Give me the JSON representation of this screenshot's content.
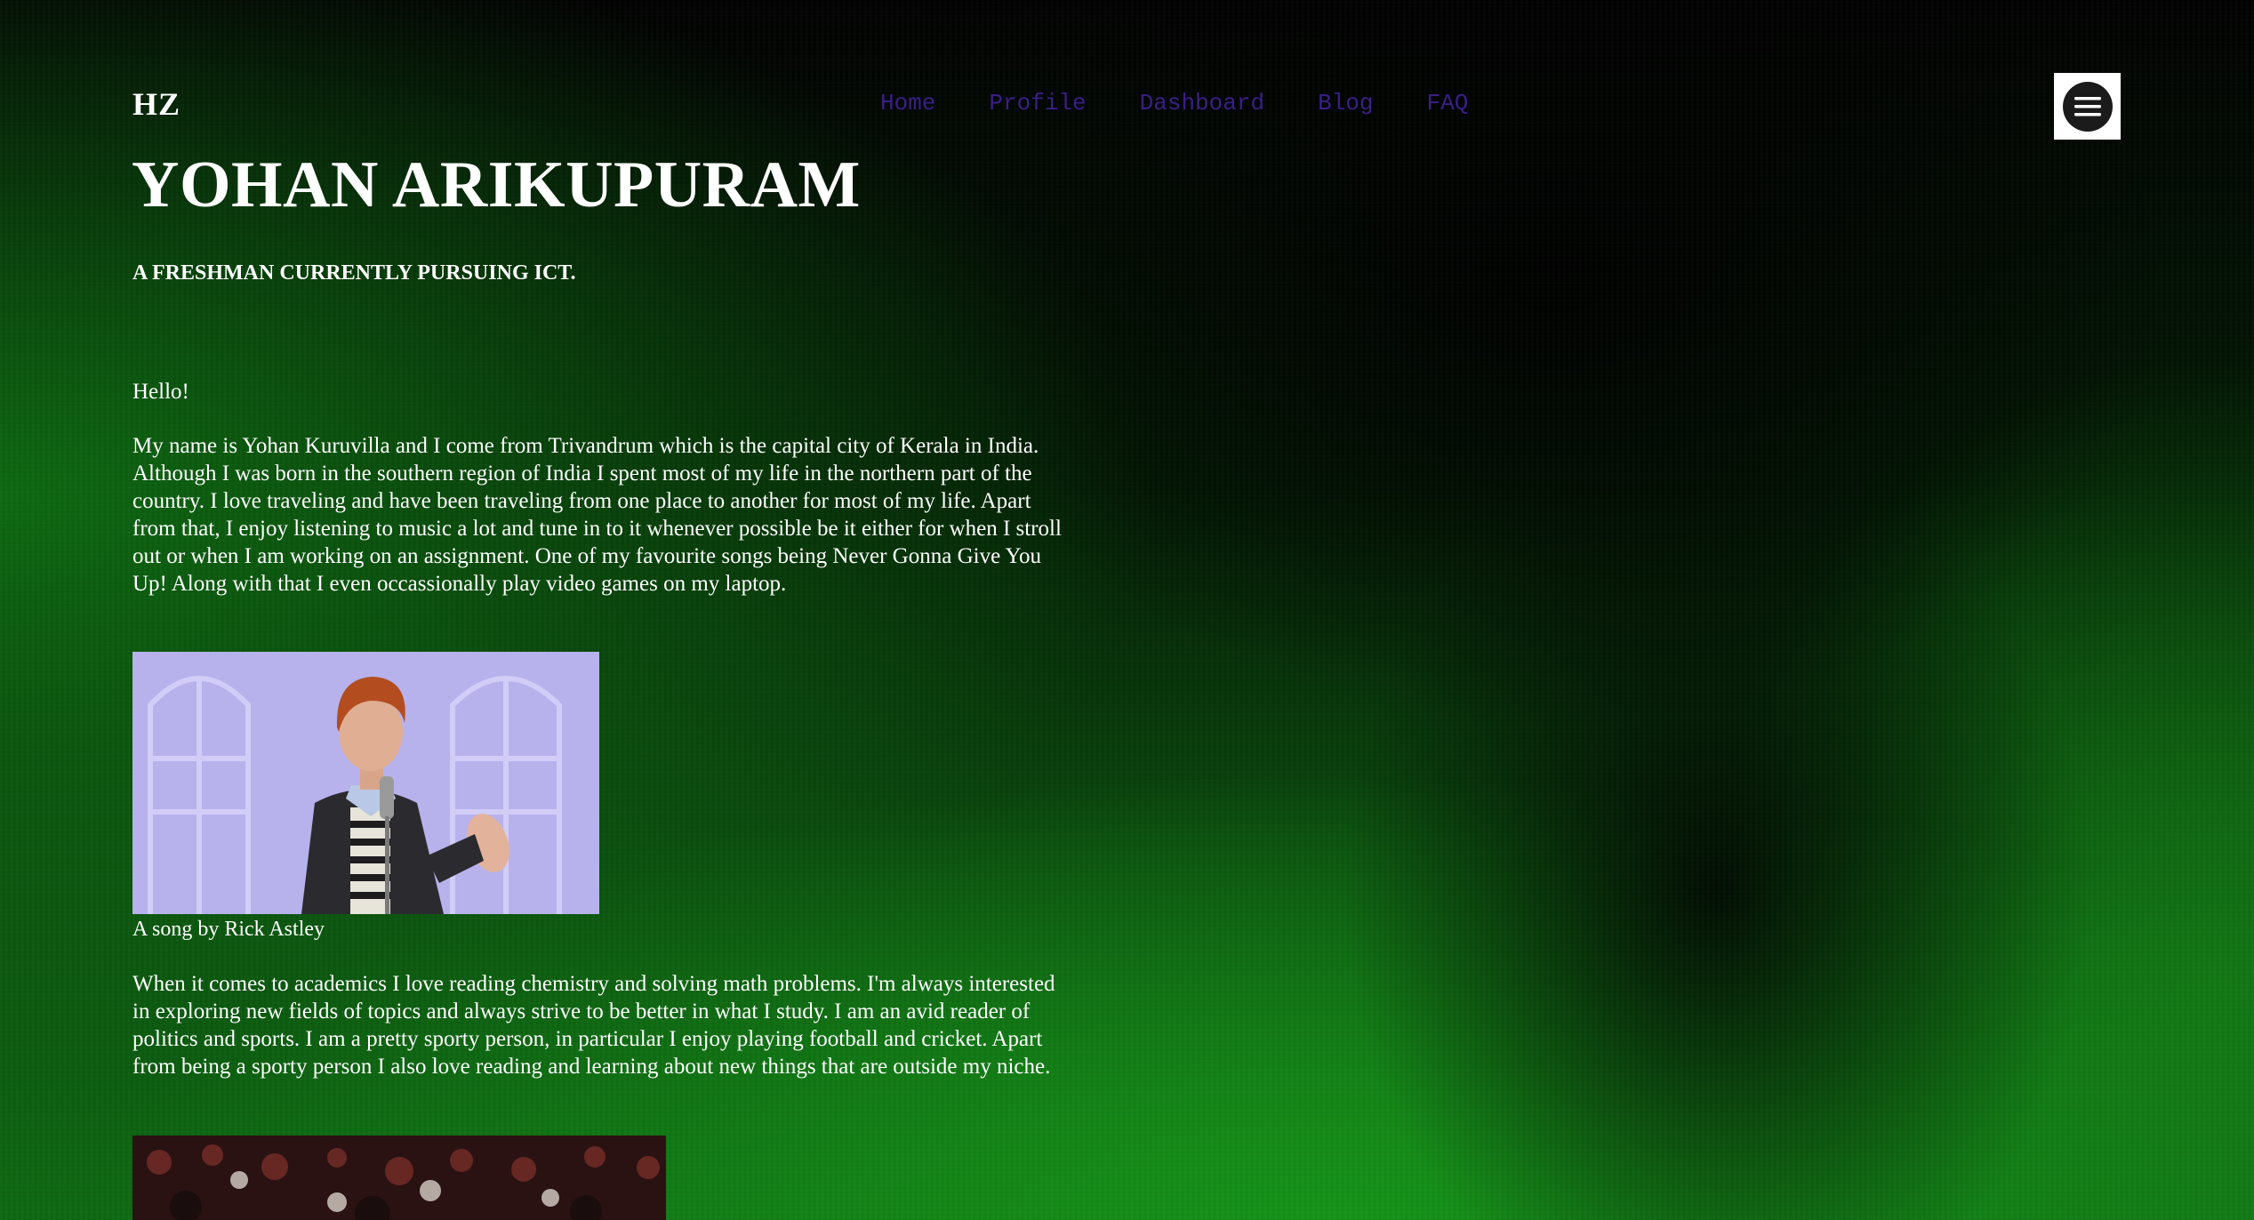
{
  "brand": {
    "logo_text": "HZ"
  },
  "nav": {
    "items": [
      {
        "label": "Home"
      },
      {
        "label": "Profile"
      },
      {
        "label": "Dashboard"
      },
      {
        "label": "Blog"
      },
      {
        "label": "FAQ"
      }
    ],
    "link_color": "#3a1f86",
    "menu_icon": "hamburger-menu-icon"
  },
  "hero": {
    "title": "YOHAN ARIKUPURAM",
    "subtitle": "A FRESHMAN CURRENTLY PURSUING ICT."
  },
  "content": {
    "greeting": "Hello!",
    "paragraph1": "My name is Yohan Kuruvilla and I come from Trivandrum which is the capital city of Kerala in India. Although I was born in the southern region of India I spent most of my life in the northern part of the country. I love traveling and have been traveling from one place to another for most of my life. Apart from that, I enjoy listening to music a lot and tune in to it whenever possible be it either for when I stroll out or when I am working on an assignment. One of my favourite songs being Never Gonna Give You Up! Along with that I even occassionally play video games on my laptop.",
    "image1_caption": "A song by Rick Astley",
    "paragraph2": "When it comes to academics I love reading chemistry and solving math problems. I'm always interested in exploring new fields of topics and always strive to be better in what I study. I am an avid reader of politics and sports. I am a pretty sporty person, in particular I enjoy playing football and cricket. Apart from being a sporty person I also love reading and learning about new things that are outside my niche."
  },
  "colors": {
    "text": "#ffffff",
    "background_dark": "#000000",
    "background_green": "#0e6a12"
  }
}
